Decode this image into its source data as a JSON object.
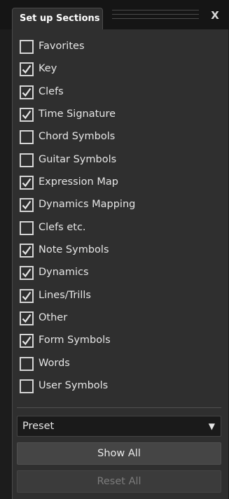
{
  "panel": {
    "tab_title": "Set up Sections",
    "close_symbol": "X"
  },
  "sections": [
    {
      "label": "Favorites",
      "checked": false
    },
    {
      "label": "Key",
      "checked": true
    },
    {
      "label": "Clefs",
      "checked": true
    },
    {
      "label": "Time Signature",
      "checked": true
    },
    {
      "label": "Chord Symbols",
      "checked": false
    },
    {
      "label": "Guitar Symbols",
      "checked": false
    },
    {
      "label": "Expression Map",
      "checked": true
    },
    {
      "label": "Dynamics Mapping",
      "checked": true
    },
    {
      "label": "Clefs etc.",
      "checked": false
    },
    {
      "label": "Note Symbols",
      "checked": true
    },
    {
      "label": "Dynamics",
      "checked": true
    },
    {
      "label": "Lines/Trills",
      "checked": true
    },
    {
      "label": "Other",
      "checked": true
    },
    {
      "label": "Form Symbols",
      "checked": true
    },
    {
      "label": "Words",
      "checked": false
    },
    {
      "label": "User Symbols",
      "checked": false
    }
  ],
  "footer": {
    "preset_label": "Preset",
    "preset_icon": "chevron-down-icon",
    "show_all_label": "Show All",
    "reset_all_label": "Reset All",
    "reset_all_enabled": false
  },
  "colors": {
    "background": "#2f2f2f",
    "header": "#151515",
    "text": "#e6e6e6",
    "disabled_text": "#7c7c7c"
  }
}
